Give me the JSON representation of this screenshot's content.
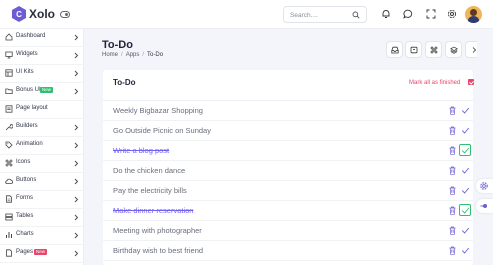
{
  "header": {
    "brand": "Xolo",
    "search_placeholder": "Search....",
    "accent": "#6c5dd3"
  },
  "sidebar": {
    "items": [
      {
        "label": "Dashboard",
        "icon": "home-icon"
      },
      {
        "label": "Widgets",
        "icon": "monitor-icon"
      },
      {
        "label": "UI Kits",
        "icon": "layout-icon"
      },
      {
        "label": "Bonus UI",
        "icon": "folder-icon",
        "badge": "New",
        "badge_color": "#2fbf71"
      },
      {
        "label": "Page layout",
        "icon": "page-layout-icon"
      },
      {
        "label": "Builders",
        "icon": "tool-icon"
      },
      {
        "label": "Animation",
        "icon": "tag-icon"
      },
      {
        "label": "Icons",
        "icon": "command-icon"
      },
      {
        "label": "Buttons",
        "icon": "cloud-icon"
      },
      {
        "label": "Forms",
        "icon": "file-text-icon"
      },
      {
        "label": "Tables",
        "icon": "server-icon"
      },
      {
        "label": "Charts",
        "icon": "bar-chart-icon"
      },
      {
        "label": "Pages",
        "icon": "file-icon",
        "badge": "New",
        "badge_color": "#e8456b"
      }
    ]
  },
  "page": {
    "title": "To-Do",
    "breadcrumb": [
      "Home",
      "Apps",
      "To-Do"
    ]
  },
  "card": {
    "title": "To-Do",
    "mark_all_label": "Mark all as finished",
    "tasks": [
      {
        "text": "Weekly Bigbazar Shopping",
        "done": false
      },
      {
        "text": "Go Outside Picnic on Sunday",
        "done": false
      },
      {
        "text": "Write a blog post",
        "done": true
      },
      {
        "text": "Do the chicken dance",
        "done": false
      },
      {
        "text": "Pay the electricity bills",
        "done": false
      },
      {
        "text": "Make dinner reservation",
        "done": true
      },
      {
        "text": "Meeting with photographer",
        "done": false
      },
      {
        "text": "Birthday wish to best friend",
        "done": false
      }
    ]
  }
}
